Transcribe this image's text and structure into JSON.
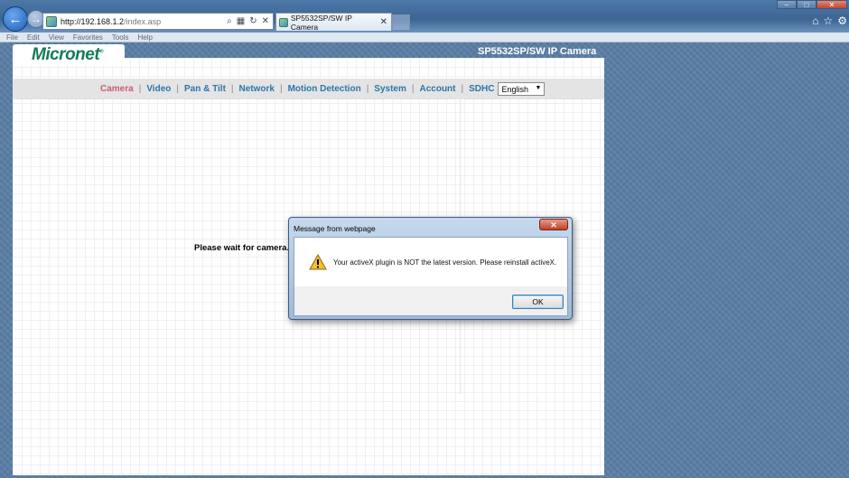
{
  "browser": {
    "url_host": "http://192.168.1.2",
    "url_path": "/index.asp",
    "tab_title": "SP5532SP/SW IP Camera",
    "menu": [
      "File",
      "Edit",
      "View",
      "Favorites",
      "Tools",
      "Help"
    ]
  },
  "page": {
    "logo": "Micronet",
    "header_title": "SP5532SP/SW IP Camera",
    "nav": [
      "Camera",
      "Video",
      "Pan & Tilt",
      "Network",
      "Motion Detection",
      "System",
      "Account",
      "SDHC"
    ],
    "active_nav": "Camera",
    "language": "English",
    "wait_message": "Please wait for camera."
  },
  "dialog": {
    "title": "Message from webpage",
    "message": "Your activeX plugin is NOT the latest version. Please reinstall activeX.",
    "ok_label": "OK"
  },
  "icons": {
    "back": "back-arrow-icon",
    "forward": "forward-arrow-icon",
    "warning": "warning-icon",
    "close": "close-icon"
  },
  "colors": {
    "active_nav": "#d05a72",
    "nav_link": "#2b76a8",
    "logo": "#157a59"
  }
}
